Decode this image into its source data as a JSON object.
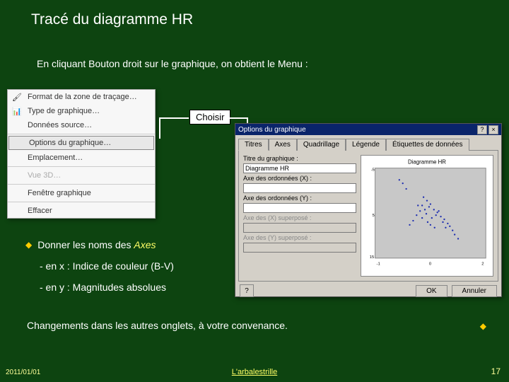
{
  "title": "Tracé du diagramme HR",
  "subtitle": "En cliquant Bouton droit sur le graphique, on obtient le Menu :",
  "choisir": "Choisir",
  "context_menu": {
    "items": [
      {
        "label": "Format de la zone de traçage…",
        "icon": "paint"
      },
      {
        "label": "Type de graphique…",
        "icon": "chart"
      },
      {
        "label": "Données source…",
        "icon": ""
      },
      {
        "label": "Options du graphique…",
        "selected": true
      },
      {
        "label": "Emplacement…",
        "icon": ""
      },
      {
        "label": "Vue 3D…",
        "disabled": true
      },
      {
        "label": "Fenêtre graphique"
      },
      {
        "label": "Effacer"
      }
    ]
  },
  "dialog": {
    "title": "Options du graphique",
    "tabs": [
      "Titres",
      "Axes",
      "Quadrillage",
      "Légende",
      "Étiquettes de données"
    ],
    "active_tab": 0,
    "fields": {
      "chart_title_label": "Titre du graphique :",
      "chart_title_value": "Diagramme HR",
      "x_label": "Axe des ordonnées (X) :",
      "x_value": "",
      "y_label": "Axe des ordonnées (Y) :",
      "y_value": "",
      "x2_label": "Axe des (X) superposé :",
      "y2_label": "Axe des (Y) superposé :"
    },
    "preview_title": "Diagramme HR",
    "buttons": {
      "ok": "OK",
      "cancel": "Annuler",
      "help": "?"
    }
  },
  "bullets": {
    "line1_pre": "Donner les noms des ",
    "line1_em": "Axes",
    "line2": "- en x  : Indice de couleur (B-V)",
    "line3": "- en y : Magnitudes absolues",
    "line4": "Changements dans les autres onglets, à votre convenance."
  },
  "footer": {
    "date": "2011/01/01",
    "center": "L'arbalestrille",
    "page": "17"
  }
}
